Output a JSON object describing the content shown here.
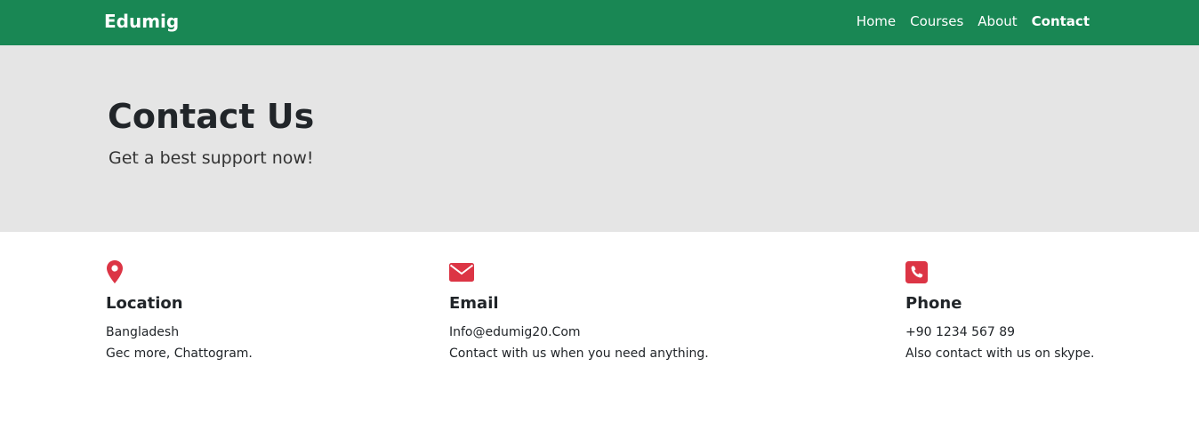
{
  "navbar": {
    "brand": "Edumig",
    "links": [
      {
        "label": "Home"
      },
      {
        "label": "Courses"
      },
      {
        "label": "About"
      },
      {
        "label": "Contact"
      }
    ],
    "background": "#198754"
  },
  "hero": {
    "title": "Contact Us",
    "subtitle": "Get a best support now!",
    "background": "#e5e5e5"
  },
  "contacts": [
    {
      "icon": "location-pin-icon",
      "heading": "Location",
      "lines": [
        "Bangladesh",
        "Gec more, Chattogram."
      ]
    },
    {
      "icon": "envelope-icon",
      "heading": "Email",
      "lines": [
        "Info@edumig20.Com",
        "Contact with us when you need anything."
      ]
    },
    {
      "icon": "phone-icon",
      "heading": "Phone",
      "lines": [
        "+90 1234 567 89",
        "Also contact with us on skype."
      ]
    }
  ],
  "icon_color": "#dc3545"
}
